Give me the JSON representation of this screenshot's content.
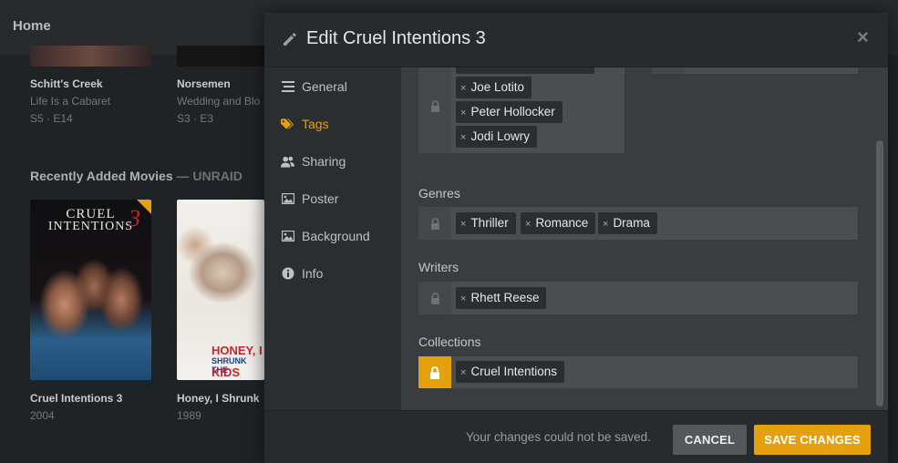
{
  "background": {
    "header_title": "Home",
    "cards_top": [
      {
        "title": "Schitt's Creek",
        "subtitle": "Life Is a Cabaret",
        "meta": "S5 · E14"
      },
      {
        "title": "Norsemen",
        "subtitle": "Wedding and Blo",
        "meta": "S3 · E3"
      }
    ],
    "section_title": "Recently Added Movies",
    "section_sep": " — ",
    "section_library": "UNRAID",
    "cards_movies": [
      {
        "title": "Cruel Intentions 3",
        "year": "2004",
        "poster_line1": "CRUEL",
        "poster_line2": "INTENTIONS",
        "poster_num": "3"
      },
      {
        "title": "Honey, I Shrunk",
        "year": "1989",
        "poster_line1": "HONEY, I",
        "poster_line2": "SHRUNK THE",
        "poster_line3": "KIDS"
      }
    ]
  },
  "modal": {
    "title": "Edit Cruel Intentions 3",
    "nav": [
      {
        "label": "General",
        "icon": "list-icon",
        "active": false
      },
      {
        "label": "Tags",
        "icon": "tag-icon",
        "active": true
      },
      {
        "label": "Sharing",
        "icon": "users-icon",
        "active": false
      },
      {
        "label": "Poster",
        "icon": "image-icon",
        "active": false
      },
      {
        "label": "Background",
        "icon": "image-icon",
        "active": false
      },
      {
        "label": "Info",
        "icon": "info-icon",
        "active": false
      }
    ],
    "top_tags": [
      "Joe Lotito",
      "Peter Hollocker",
      "Jodi Lowry"
    ],
    "fields": [
      {
        "label": "Genres",
        "locked": false,
        "tags": [
          "Thriller",
          "Romance",
          "Drama"
        ]
      },
      {
        "label": "Writers",
        "locked": false,
        "tags": [
          "Rhett Reese"
        ]
      },
      {
        "label": "Collections",
        "locked": true,
        "tags": [
          "Cruel Intentions"
        ]
      }
    ],
    "tag_remove_glyph": "×",
    "footer_message": "Your changes could not be saved.",
    "cancel_label": "CANCEL",
    "save_label": "SAVE CHANGES"
  },
  "colors": {
    "accent": "#e5a00d",
    "background": "#1f2326",
    "panel": "#2e3134"
  }
}
